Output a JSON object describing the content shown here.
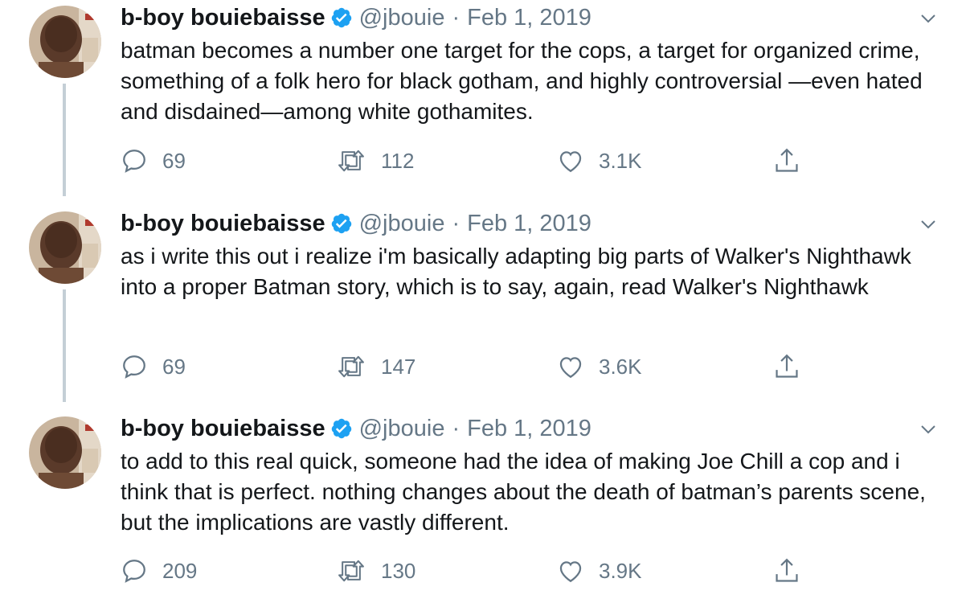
{
  "tweets": [
    {
      "author": {
        "name": "b-boy bouiebaisse",
        "handle": "@jbouie",
        "verified": true
      },
      "separator": "·",
      "date": "Feb 1, 2019",
      "text": "batman becomes a number one target for the cops, a target for organized crime, something of a folk hero for black gotham, and highly controversial —even hated and disdained—among white gothamites.",
      "stats": {
        "replies": "69",
        "retweets": "112",
        "likes": "3.1K"
      }
    },
    {
      "author": {
        "name": "b-boy bouiebaisse",
        "handle": "@jbouie",
        "verified": true
      },
      "separator": "·",
      "date": "Feb 1, 2019",
      "text": "as i write this out i realize i'm basically adapting big parts of Walker's Nighthawk into a proper Batman story, which is to say, again, read Walker's Nighthawk",
      "stats": {
        "replies": "69",
        "retweets": "147",
        "likes": "3.6K"
      }
    },
    {
      "author": {
        "name": "b-boy bouiebaisse",
        "handle": "@jbouie",
        "verified": true
      },
      "separator": "·",
      "date": "Feb 1, 2019",
      "text": "to add to this real quick, someone had the idea of making Joe Chill a cop and i think that is perfect. nothing changes about the death of batman’s parents scene, but the implications are vastly different.",
      "stats": {
        "replies": "209",
        "retweets": "130",
        "likes": "3.9K"
      }
    }
  ],
  "icons": {
    "verified": "verified-badge-icon",
    "menu": "chevron-down-icon",
    "reply": "reply-icon",
    "retweet": "retweet-icon",
    "like": "heart-icon",
    "share": "share-icon"
  },
  "colors": {
    "text": "#14171a",
    "secondary": "#657786",
    "verified": "#1da1f2",
    "thread_line": "#c4cfd6"
  }
}
